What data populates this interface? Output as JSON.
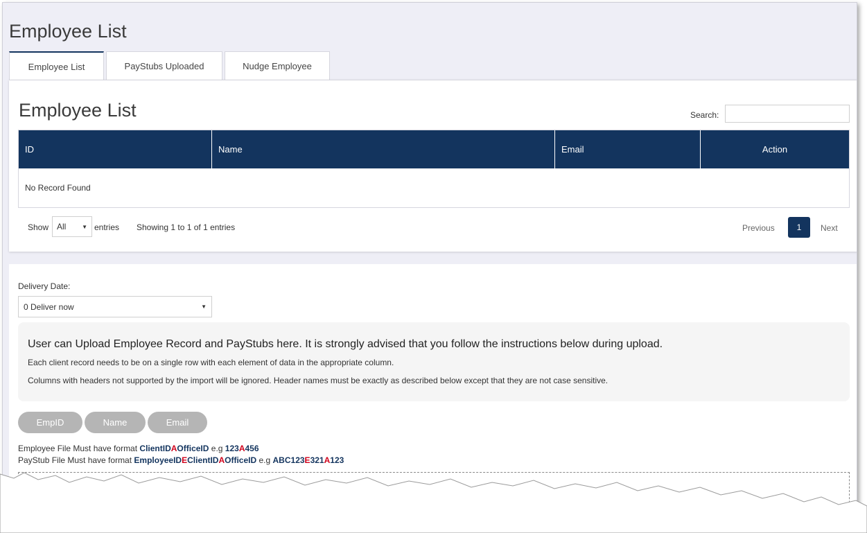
{
  "page": {
    "title": "Employee List"
  },
  "tabs": [
    {
      "label": "Employee List"
    },
    {
      "label": "PayStubs Uploaded"
    },
    {
      "label": "Nudge Employee"
    }
  ],
  "list_panel": {
    "title": "Employee List",
    "search_label": "Search:",
    "search_value": "",
    "columns": [
      "ID",
      "Name",
      "Email",
      "Action"
    ],
    "empty_message": "No Record Found",
    "show_label": "Show",
    "entries_value": "All",
    "entries_label": "entries",
    "showing_text": "Showing 1 to 1 of 1 entries",
    "previous_label": "Previous",
    "current_page": "1",
    "next_label": "Next"
  },
  "upload_panel": {
    "delivery_label": "Delivery Date:",
    "delivery_value": "0 Deliver now",
    "info_title": "User can Upload Employee Record and PayStubs here. It is strongly advised that you follow the instructions below during upload.",
    "info_line1": "Each client record needs to be on a single row with each element of data in the appropriate column.",
    "info_line2": "Columns with headers not supported by the import will be ignored. Header names must be exactly as described below except that they are not case sensitive.",
    "header_pills": [
      "EmpID",
      "Name",
      "Email"
    ],
    "employee_format": {
      "prefix": "Employee File Must have format ",
      "parts": [
        "ClientID",
        "A",
        "OfficeID"
      ],
      "eg_label": " e.g ",
      "example": [
        "123",
        "A",
        "456"
      ]
    },
    "paystub_format": {
      "prefix": "PayStub File Must have format ",
      "parts": [
        "EmployeeID",
        "E",
        "ClientID",
        "A",
        "OfficeID"
      ],
      "eg_label": " e.g ",
      "example": [
        "ABC123",
        "E",
        "321",
        "A",
        "123"
      ]
    }
  },
  "colors": {
    "primary": "#13345e",
    "accent_red": "#d0021b",
    "pill_gray": "#b5b5b5"
  }
}
